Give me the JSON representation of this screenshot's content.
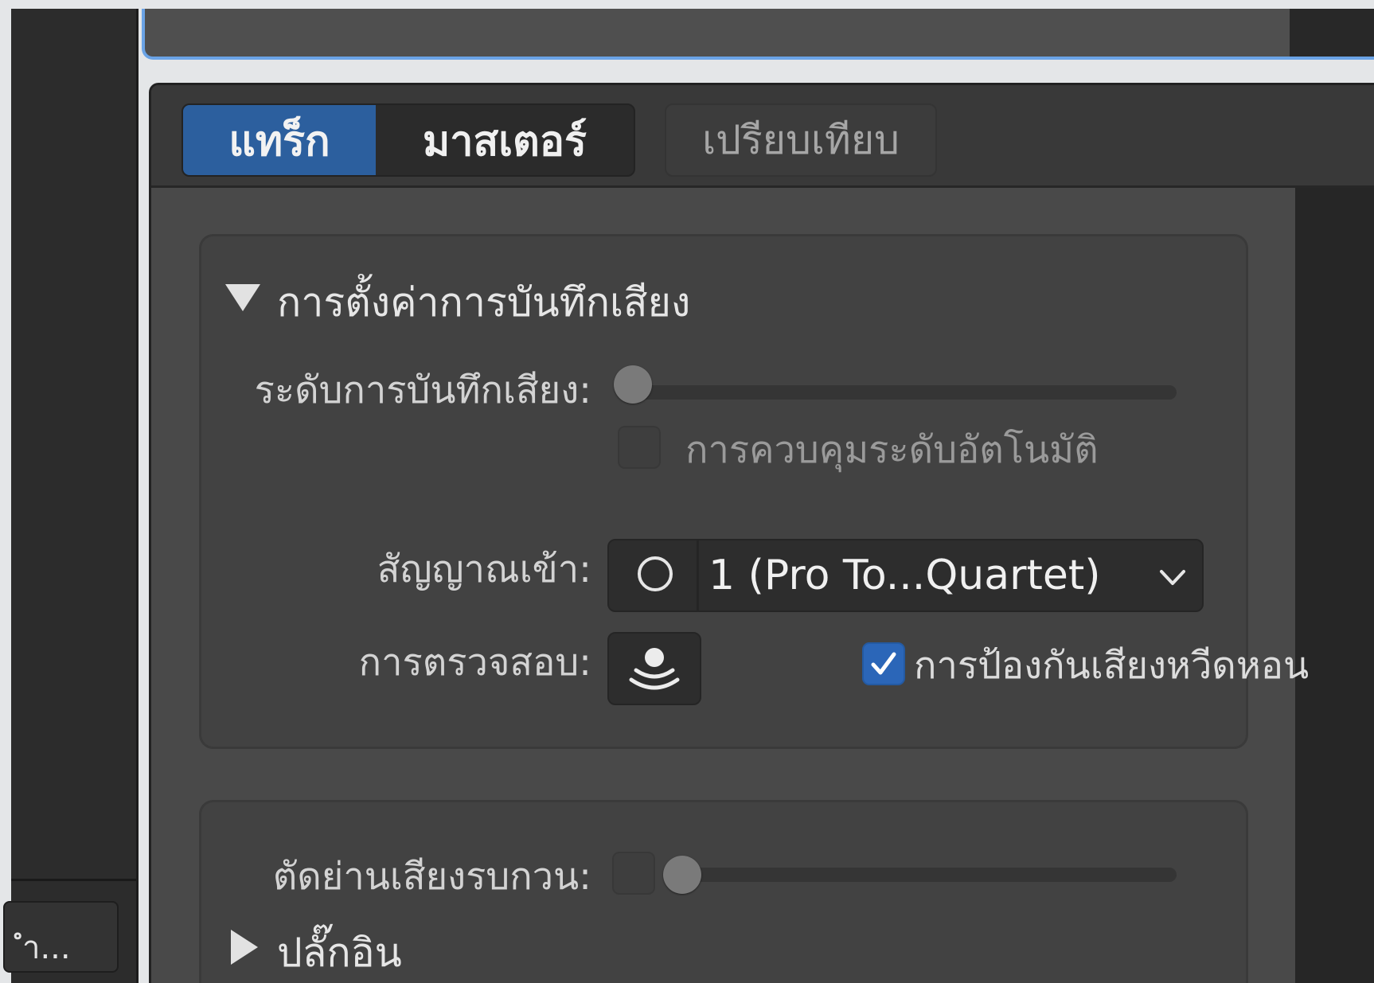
{
  "left_panel": {
    "bottom_button_label": "ำ..."
  },
  "tabs": {
    "track": "แทร็ก",
    "master": "มาสเตอร์",
    "compare": "เปรียบเทียบ"
  },
  "recording_settings": {
    "title": "การตั้งค่าการบันทึกเสียง",
    "level_label": "ระดับการบันทึกเสียง:",
    "level_value": 0,
    "auto_level_label": "การควบคุมระดับอัตโนมัติ",
    "auto_level_checked": false,
    "input_label": "สัญญาณเข้า:",
    "input_value": "1  (Pro To...Quartet)",
    "monitoring_label": "การตรวจสอบ:",
    "feedback_label": "การป้องกันเสียงหวีดหอน",
    "feedback_checked": true
  },
  "noise": {
    "gate_label": "ตัดย่านเสียงรบกวน:",
    "gate_checked": false,
    "gate_value": 0,
    "plugins_label": "ปลั๊กอิน"
  },
  "colors": {
    "accent": "#2c5f9e",
    "focus_ring": "#6aa3e6",
    "checkbox_checked": "#2b66b8"
  }
}
